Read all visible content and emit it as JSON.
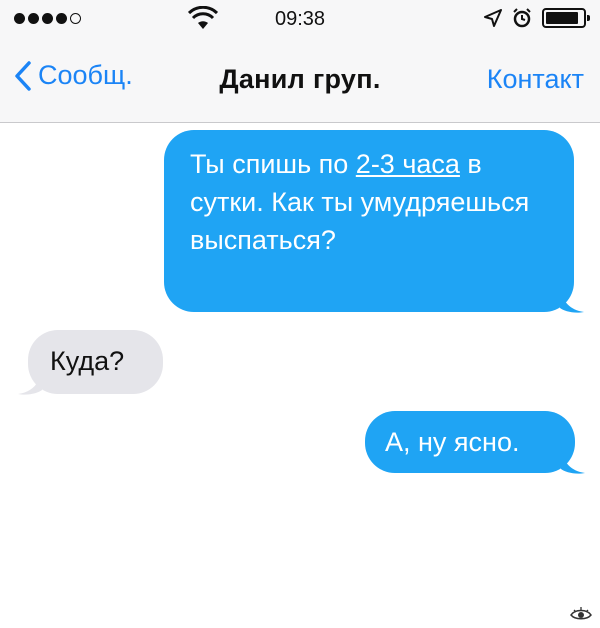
{
  "status_bar": {
    "time": "09:38",
    "signal_icon": "signal-dots-icon",
    "wifi_icon": "wifi-icon",
    "location_icon": "location-arrow-icon",
    "alarm_icon": "alarm-clock-icon",
    "battery_icon": "battery-icon"
  },
  "nav": {
    "back_label": "Сообщ.",
    "title": "Данил груп.",
    "contact_label": "Контакт"
  },
  "messages": [
    {
      "side": "outgoing",
      "text_before": "Ты спишь по ",
      "link_text": "2-3 часа",
      "text_after": " в сутки. Как ты умудряешься выспаться?"
    },
    {
      "side": "incoming",
      "text": "Куда?"
    },
    {
      "side": "outgoing",
      "text": "А, ну ясно."
    }
  ],
  "colors": {
    "accent_blue": "#1b84f6",
    "outgoing_bubble": "#1fa4f4",
    "incoming_bubble": "#e5e5ea",
    "nav_background": "#f7f7f8"
  },
  "watermark_icon": "eye-watermark-icon"
}
